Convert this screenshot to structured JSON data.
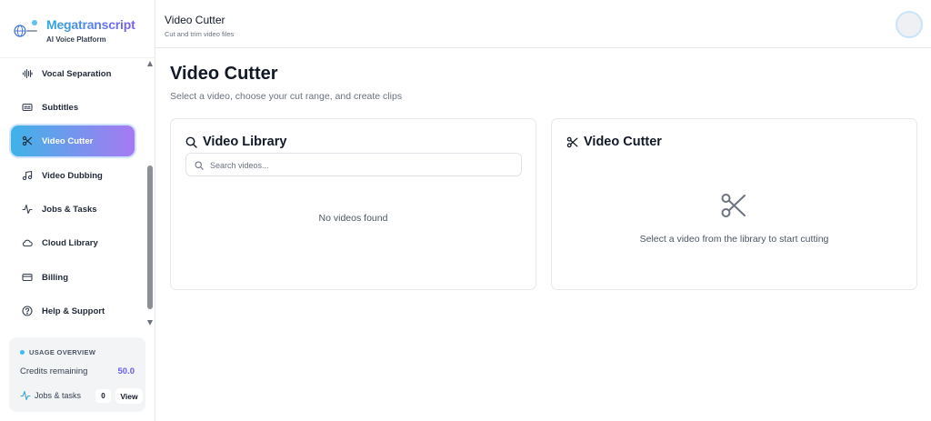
{
  "brand": {
    "name": "Megatranscript",
    "subtitle": "AI Voice Platform",
    "logo_icon": "globe-logo-icon"
  },
  "sidebar": {
    "items": [
      {
        "label": "Vocal Separation",
        "icon": "waveform-icon",
        "active": false
      },
      {
        "label": "Subtitles",
        "icon": "subtitles-icon",
        "active": false
      },
      {
        "label": "Video Cutter",
        "icon": "scissors-icon",
        "active": true
      },
      {
        "label": "Video Dubbing",
        "icon": "music-note-icon",
        "active": false
      },
      {
        "label": "Jobs & Tasks",
        "icon": "activity-icon",
        "active": false
      },
      {
        "label": "Cloud Library",
        "icon": "cloud-icon",
        "active": false
      },
      {
        "label": "Billing",
        "icon": "credit-card-icon",
        "active": false
      },
      {
        "label": "Help & Support",
        "icon": "help-circle-icon",
        "active": false
      }
    ]
  },
  "usage": {
    "title": "USAGE OVERVIEW",
    "credits_label": "Credits remaining",
    "credits_value": "50.0",
    "jobs_label": "Jobs & tasks",
    "jobs_count": "0",
    "view_label": "View"
  },
  "header": {
    "title": "Video Cutter",
    "subtitle": "Cut and trim video files"
  },
  "main": {
    "title": "Video Cutter",
    "subtitle": "Select a video, choose your cut range, and create clips",
    "library": {
      "title": "Video Library",
      "search_placeholder": "Search videos...",
      "empty_text": "No videos found"
    },
    "cutter": {
      "title": "Video Cutter",
      "empty_text": "Select a video from the library to start cutting"
    }
  },
  "colors": {
    "accent_start": "#3fb3e8",
    "accent_end": "#a779f2",
    "credits": "#6b5cf0"
  }
}
